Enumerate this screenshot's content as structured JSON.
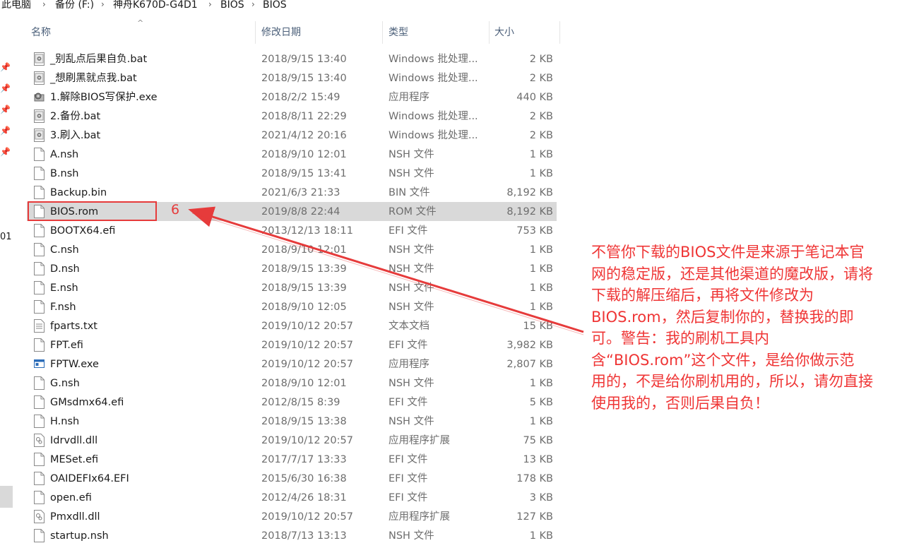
{
  "breadcrumb": {
    "items": [
      "此电脑",
      "备份 (F:)",
      "神舟K670D-G4D1",
      "BIOS",
      "BIOS"
    ],
    "separator": "›"
  },
  "left": {
    "label": "01",
    "pin_icon": "pin-icon"
  },
  "columns": {
    "name": "名称",
    "date": "修改日期",
    "type": "类型",
    "size": "大小",
    "sort_icon": "sort-up-caret"
  },
  "files": [
    {
      "name": "_别乱点后果自负.bat",
      "date": "2018/9/15 13:40",
      "type": "Windows 批处理...",
      "size": "2 KB",
      "icon": "bat"
    },
    {
      "name": "_想刷黑就点我.bat",
      "date": "2018/9/15 13:40",
      "type": "Windows 批处理...",
      "size": "2 KB",
      "icon": "bat"
    },
    {
      "name": "1.解除BIOS写保护.exe",
      "date": "2018/2/2 15:49",
      "type": "应用程序",
      "size": "440 KB",
      "icon": "exe-gear"
    },
    {
      "name": "2.备份.bat",
      "date": "2018/8/11 22:29",
      "type": "Windows 批处理...",
      "size": "2 KB",
      "icon": "bat"
    },
    {
      "name": "3.刷入.bat",
      "date": "2021/4/12 20:16",
      "type": "Windows 批处理...",
      "size": "2 KB",
      "icon": "bat"
    },
    {
      "name": "A.nsh",
      "date": "2018/9/10 12:01",
      "type": "NSH 文件",
      "size": "1 KB",
      "icon": "file"
    },
    {
      "name": "B.nsh",
      "date": "2018/9/15 13:41",
      "type": "NSH 文件",
      "size": "1 KB",
      "icon": "file"
    },
    {
      "name": "Backup.bin",
      "date": "2021/6/3 21:33",
      "type": "BIN 文件",
      "size": "8,192 KB",
      "icon": "file"
    },
    {
      "name": "BIOS.rom",
      "date": "2019/8/8 22:44",
      "type": "ROM 文件",
      "size": "8,192 KB",
      "icon": "file",
      "selected": true
    },
    {
      "name": "BOOTX64.efi",
      "date": "2013/12/13 18:11",
      "type": "EFI 文件",
      "size": "753 KB",
      "icon": "file"
    },
    {
      "name": "C.nsh",
      "date": "2018/9/10 12:01",
      "type": "NSH 文件",
      "size": "1 KB",
      "icon": "file"
    },
    {
      "name": "D.nsh",
      "date": "2018/9/15 13:39",
      "type": "NSH 文件",
      "size": "1 KB",
      "icon": "file"
    },
    {
      "name": "E.nsh",
      "date": "2018/9/15 13:39",
      "type": "NSH 文件",
      "size": "1 KB",
      "icon": "file"
    },
    {
      "name": "F.nsh",
      "date": "2018/9/10 12:05",
      "type": "NSH 文件",
      "size": "1 KB",
      "icon": "file"
    },
    {
      "name": "fparts.txt",
      "date": "2019/10/12 20:57",
      "type": "文本文档",
      "size": "15 KB",
      "icon": "txt"
    },
    {
      "name": "FPT.efi",
      "date": "2019/10/12 20:57",
      "type": "EFI 文件",
      "size": "3,982 KB",
      "icon": "file"
    },
    {
      "name": "FPTW.exe",
      "date": "2019/10/12 20:57",
      "type": "应用程序",
      "size": "2,807 KB",
      "icon": "exe-window"
    },
    {
      "name": "G.nsh",
      "date": "2018/9/10 12:01",
      "type": "NSH 文件",
      "size": "1 KB",
      "icon": "file"
    },
    {
      "name": "GMsdmx64.efi",
      "date": "2012/8/15 8:39",
      "type": "EFI 文件",
      "size": "5 KB",
      "icon": "file"
    },
    {
      "name": "H.nsh",
      "date": "2018/9/15 13:38",
      "type": "NSH 文件",
      "size": "1 KB",
      "icon": "file"
    },
    {
      "name": "Idrvdll.dll",
      "date": "2019/10/12 20:57",
      "type": "应用程序扩展",
      "size": "75 KB",
      "icon": "dll"
    },
    {
      "name": "MESet.efi",
      "date": "2017/7/17 13:33",
      "type": "EFI 文件",
      "size": "13 KB",
      "icon": "file"
    },
    {
      "name": "OAIDEFIx64.EFI",
      "date": "2015/6/30 16:38",
      "type": "EFI 文件",
      "size": "178 KB",
      "icon": "file"
    },
    {
      "name": "open.efi",
      "date": "2012/4/26 18:31",
      "type": "EFI 文件",
      "size": "3 KB",
      "icon": "file"
    },
    {
      "name": "Pmxdll.dll",
      "date": "2019/10/12 20:57",
      "type": "应用程序扩展",
      "size": "127 KB",
      "icon": "dll"
    },
    {
      "name": "startup.nsh",
      "date": "2018/7/13 13:13",
      "type": "NSH 文件",
      "size": "1 KB",
      "icon": "file"
    }
  ],
  "annotation": {
    "number": "6",
    "color": "#e63b3b",
    "note": "不管你下载的BIOS文件是来源于笔记本官\n网的稳定版，还是其他渠道的魔改版，请将\n下载的解压缩后，再将文件修改为\nBIOS.rom，然后复制你的，替换我的即\n可。警告：我的刷机工具内\n含“BIOS.rom”这个文件，是给你做示范\n用的，不是给你刷机用的，所以，请勿直接\n使用我的，否则后果自负！"
  },
  "colors": {
    "header_text": "#4c607a",
    "selected_row": "#d9d9d9",
    "note_text": "#ef3535"
  }
}
